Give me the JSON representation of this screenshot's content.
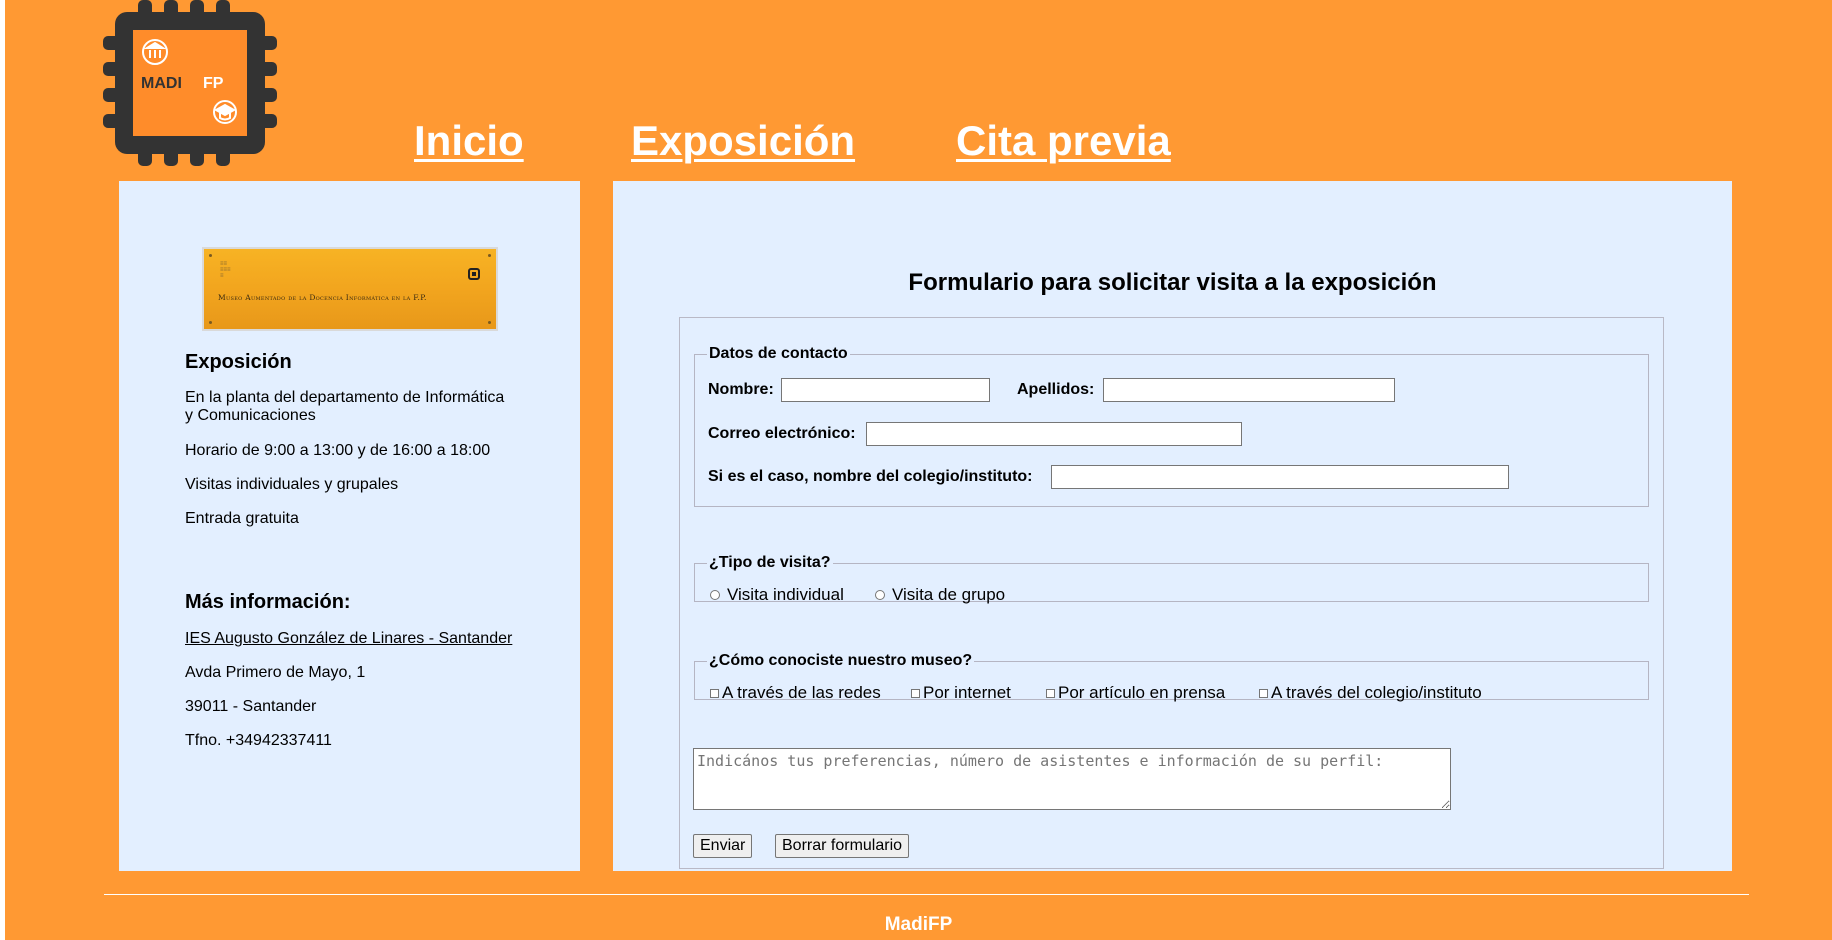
{
  "logo": {
    "text": "MADIFP",
    "text_a": "MADI",
    "text_b": "FP"
  },
  "nav": {
    "items": [
      {
        "label": "Inicio"
      },
      {
        "label": "Exposición"
      },
      {
        "label": "Cita previa"
      }
    ]
  },
  "sidebar": {
    "plaque_text": "Museo Aumentado de la Docencia Informática en la F.P.",
    "expo_heading": "Exposición",
    "expo_lines": [
      "En la planta del departamento de Informática y Comunicaciones",
      "Horario de 9:00 a 13:00 y de 16:00 a 18:00",
      "Visitas individuales y grupales",
      "Entrada gratuita"
    ],
    "more_heading": "Más información:",
    "link": "IES Augusto González de Linares - Santander",
    "address": "Avda Primero de Mayo, 1",
    "city": "39011 - Santander",
    "phone": "Tfno. +34942337411"
  },
  "form": {
    "title": "Formulario para solicitar visita a la exposición",
    "contact": {
      "legend": "Datos de contacto",
      "name_label": "Nombre:",
      "name_value": "",
      "surname_label": "Apellidos:",
      "surname_value": "",
      "email_label": "Correo electrónico:",
      "email_value": "",
      "school_label": "Si es el caso, nombre del colegio/instituto:",
      "school_value": ""
    },
    "visit_type": {
      "legend": "¿Tipo de visita?",
      "options": [
        "Visita individual",
        "Visita de grupo"
      ]
    },
    "source": {
      "legend": "¿Cómo conociste nuestro museo?",
      "options": [
        "A través de las redes",
        "Por internet",
        "Por artículo en prensa",
        "A través del colegio/instituto"
      ]
    },
    "comments_placeholder": "Indicános tus preferencias, número de asistentes e información de su perfil:",
    "submit_label": "Enviar",
    "reset_label": "Borrar formulario"
  },
  "footer": {
    "text": "MadiFP"
  },
  "colors": {
    "background": "#ff9933",
    "panel": "#e3efff",
    "nav_text": "#ffffff",
    "logo_dark": "#333333"
  }
}
